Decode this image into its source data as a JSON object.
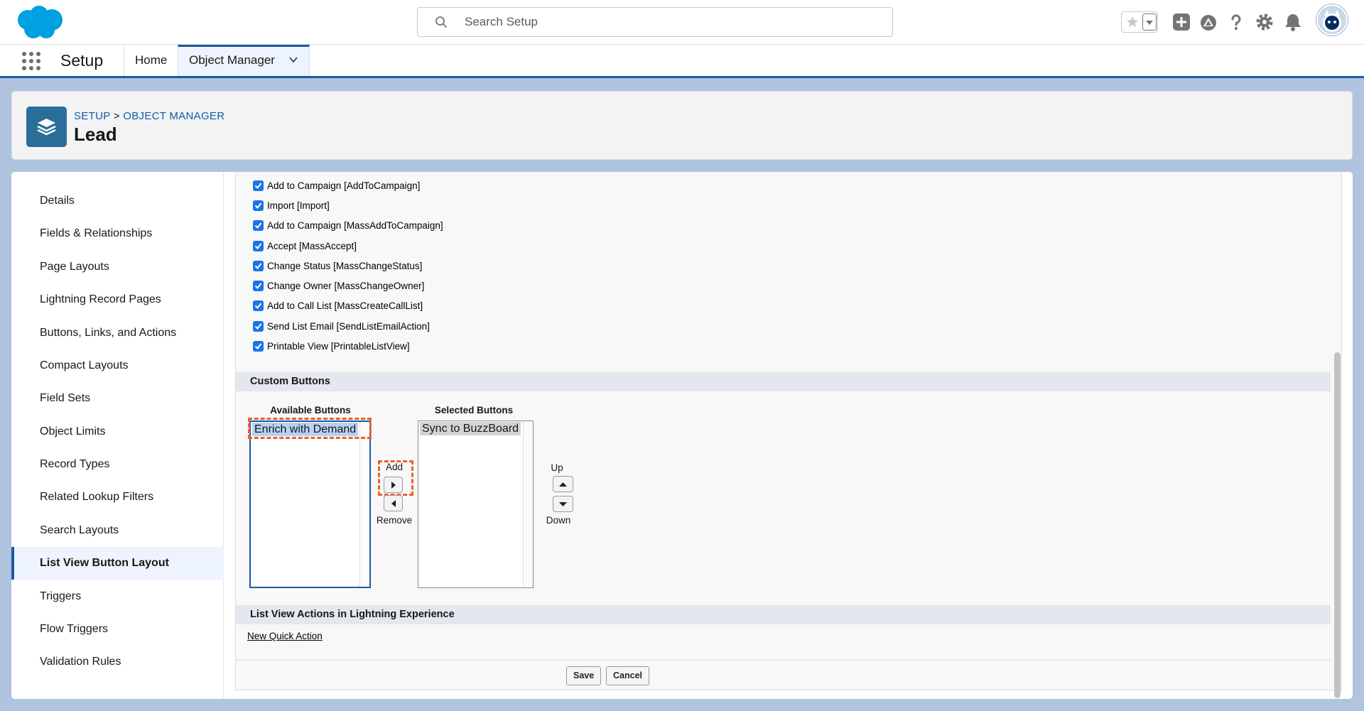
{
  "header": {
    "search_placeholder": "Search Setup"
  },
  "nav": {
    "app_name": "Setup",
    "tabs": [
      {
        "label": "Home"
      },
      {
        "label": "Object Manager"
      }
    ]
  },
  "page_header": {
    "breadcrumb_setup": "SETUP",
    "breadcrumb_sep": ">",
    "breadcrumb_object_manager": "OBJECT MANAGER",
    "title": "Lead"
  },
  "sidebar": {
    "items": [
      {
        "label": "Details"
      },
      {
        "label": "Fields & Relationships"
      },
      {
        "label": "Page Layouts"
      },
      {
        "label": "Lightning Record Pages"
      },
      {
        "label": "Buttons, Links, and Actions"
      },
      {
        "label": "Compact Layouts"
      },
      {
        "label": "Field Sets"
      },
      {
        "label": "Object Limits"
      },
      {
        "label": "Record Types"
      },
      {
        "label": "Related Lookup Filters"
      },
      {
        "label": "Search Layouts"
      },
      {
        "label": "List View Button Layout"
      },
      {
        "label": "Triggers"
      },
      {
        "label": "Flow Triggers"
      },
      {
        "label": "Validation Rules"
      }
    ],
    "active": "List View Button Layout"
  },
  "standard_buttons": [
    {
      "label": "Add to Campaign [AddToCampaign]",
      "checked": true
    },
    {
      "label": "Import [Import]",
      "checked": true
    },
    {
      "label": "Add to Campaign [MassAddToCampaign]",
      "checked": true
    },
    {
      "label": "Accept [MassAccept]",
      "checked": true
    },
    {
      "label": "Change Status [MassChangeStatus]",
      "checked": true
    },
    {
      "label": "Change Owner [MassChangeOwner]",
      "checked": true
    },
    {
      "label": "Add to Call List [MassCreateCallList]",
      "checked": true
    },
    {
      "label": "Send List Email [SendListEmailAction]",
      "checked": true
    },
    {
      "label": "Printable View [PrintableListView]",
      "checked": true
    }
  ],
  "custom_buttons": {
    "section_title": "Custom Buttons",
    "available_label": "Available Buttons",
    "available_items": [
      "Enrich with Demand"
    ],
    "selected_label": "Selected Buttons",
    "selected_items": [
      "Sync to BuzzBoard"
    ],
    "add_label": "Add",
    "remove_label": "Remove",
    "up_label": "Up",
    "down_label": "Down"
  },
  "lightning_actions": {
    "section_title": "List View Actions in Lightning Experience",
    "new_quick_action": "New Quick Action"
  },
  "footer": {
    "save_label": "Save",
    "cancel_label": "Cancel"
  },
  "colors": {
    "brand_blue": "#1b5a9f",
    "checkbox_blue": "#1a73e8",
    "highlight_orange": "#e8622b",
    "page_background": "#b0c4df"
  }
}
